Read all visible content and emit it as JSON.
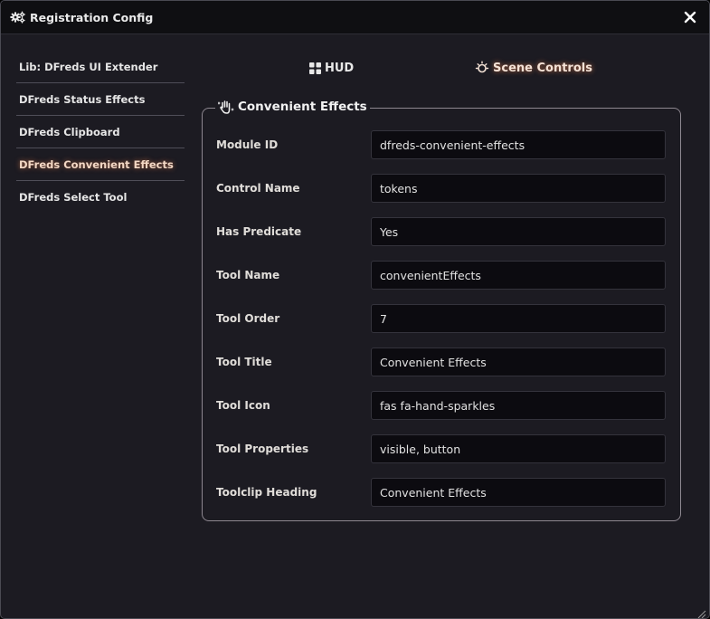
{
  "window": {
    "title": "Registration Config",
    "close_label": "×"
  },
  "sidebar": {
    "items": [
      {
        "label": "Lib: DFreds UI Extender",
        "active": false
      },
      {
        "label": "DFreds Status Effects",
        "active": false
      },
      {
        "label": "DFreds Clipboard",
        "active": false
      },
      {
        "label": "DFreds Convenient Effects",
        "active": true
      },
      {
        "label": "DFreds Select Tool",
        "active": false
      }
    ]
  },
  "tabs": [
    {
      "label": "HUD",
      "icon": "grid-icon",
      "active": false
    },
    {
      "label": "Scene Controls",
      "icon": "sun-icon",
      "active": true
    }
  ],
  "section": {
    "legend": "Convenient Effects",
    "legend_icon": "hand-sparkles-icon",
    "fields": [
      {
        "label": "Module ID",
        "value": "dfreds-convenient-effects"
      },
      {
        "label": "Control Name",
        "value": "tokens"
      },
      {
        "label": "Has Predicate",
        "value": "Yes"
      },
      {
        "label": "Tool Name",
        "value": "convenientEffects"
      },
      {
        "label": "Tool Order",
        "value": "7"
      },
      {
        "label": "Tool Title",
        "value": "Convenient Effects"
      },
      {
        "label": "Tool Icon",
        "value": "fas fa-hand-sparkles"
      },
      {
        "label": "Tool Properties",
        "value": "visible, button"
      },
      {
        "label": "Toolclip Heading",
        "value": "Convenient Effects"
      }
    ]
  },
  "colors": {
    "background": "#1c1b22",
    "input_bg": "#0c0b10",
    "active_glow": "#ff8c50",
    "border": "#8d8790"
  }
}
